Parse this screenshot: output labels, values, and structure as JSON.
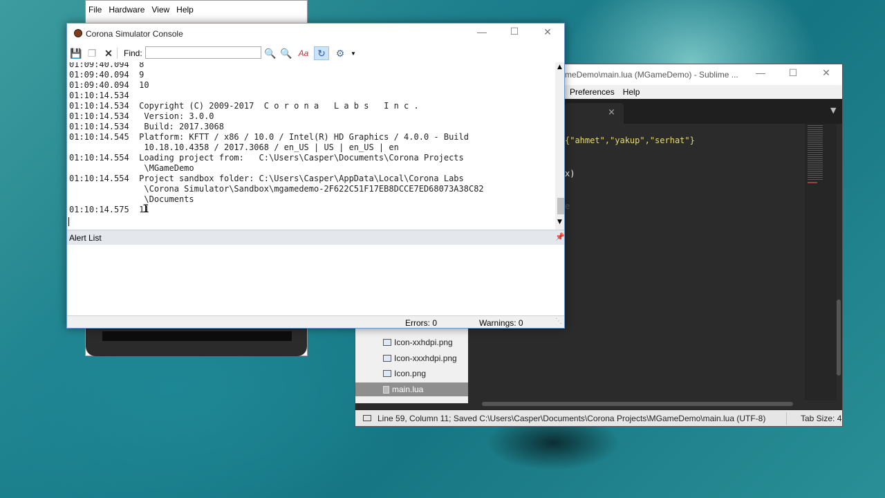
{
  "simulator": {
    "menu": [
      "File",
      "Hardware",
      "View",
      "Help"
    ]
  },
  "sublime": {
    "title": "meDemo\\main.lua (MGameDemo) - Sublime ...",
    "menu": [
      "Preferences",
      "Help"
    ],
    "tab_close": "×",
    "tabs_dropdown": "▼",
    "code_lines": [
      "{\"ahmet\",\"yakup\",\"serhat\"}",
      "x)"
    ],
    "code_faded": "e",
    "sidebar_files": [
      {
        "name": "Icon-xxhdpi.png",
        "icon": "image-file-icon"
      },
      {
        "name": "Icon-xxxhdpi.png",
        "icon": "image-file-icon"
      },
      {
        "name": "Icon.png",
        "icon": "image-file-icon"
      },
      {
        "name": "main.lua",
        "icon": "lua-file-icon",
        "selected": true
      }
    ],
    "status_text": "Line 59, Column 11; Saved C:\\Users\\Casper\\Documents\\Corona Projects\\MGameDemo\\main.lua (UTF-8)",
    "tab_size": "Tab Size: 4"
  },
  "console": {
    "title": "Corona Simulator Console",
    "find_label": "Find:",
    "find_value": "",
    "log_lines": [
      "01:09:40.094  8",
      "01:09:40.094  9",
      "01:09:40.094  10",
      "01:10:14.534",
      "01:10:14.534  Copyright (C) 2009-2017  C o r o n a   L a b s   I n c .",
      "01:10:14.534   Version: 3.0.0",
      "01:10:14.534   Build: 2017.3068",
      "01:10:14.545  Platform: KFTT / x86 / 10.0 / Intel(R) HD Graphics / 4.0.0 - Build",
      "               10.18.10.4358 / 2017.3068 / en_US | US | en_US | en",
      "01:10:14.554  Loading project from:   C:\\Users\\Casper\\Documents\\Corona Projects",
      "               \\MGameDemo",
      "01:10:14.554  Project sandbox folder: C:\\Users\\Casper\\AppData\\Local\\Corona Labs",
      "               \\Corona Simulator\\Sandbox\\mgamedemo-2F622C51F17EB8DCCE7ED68073A38C82",
      "               \\Documents",
      "01:10:14.575  11"
    ],
    "alert_list_label": "Alert List",
    "errors": "Errors: 0",
    "warnings": "Warnings: 0"
  },
  "colors": {
    "sublime_string": "#e6db74",
    "sublime_bg": "#2b2b2b",
    "console_border": "#6b9bd1"
  }
}
